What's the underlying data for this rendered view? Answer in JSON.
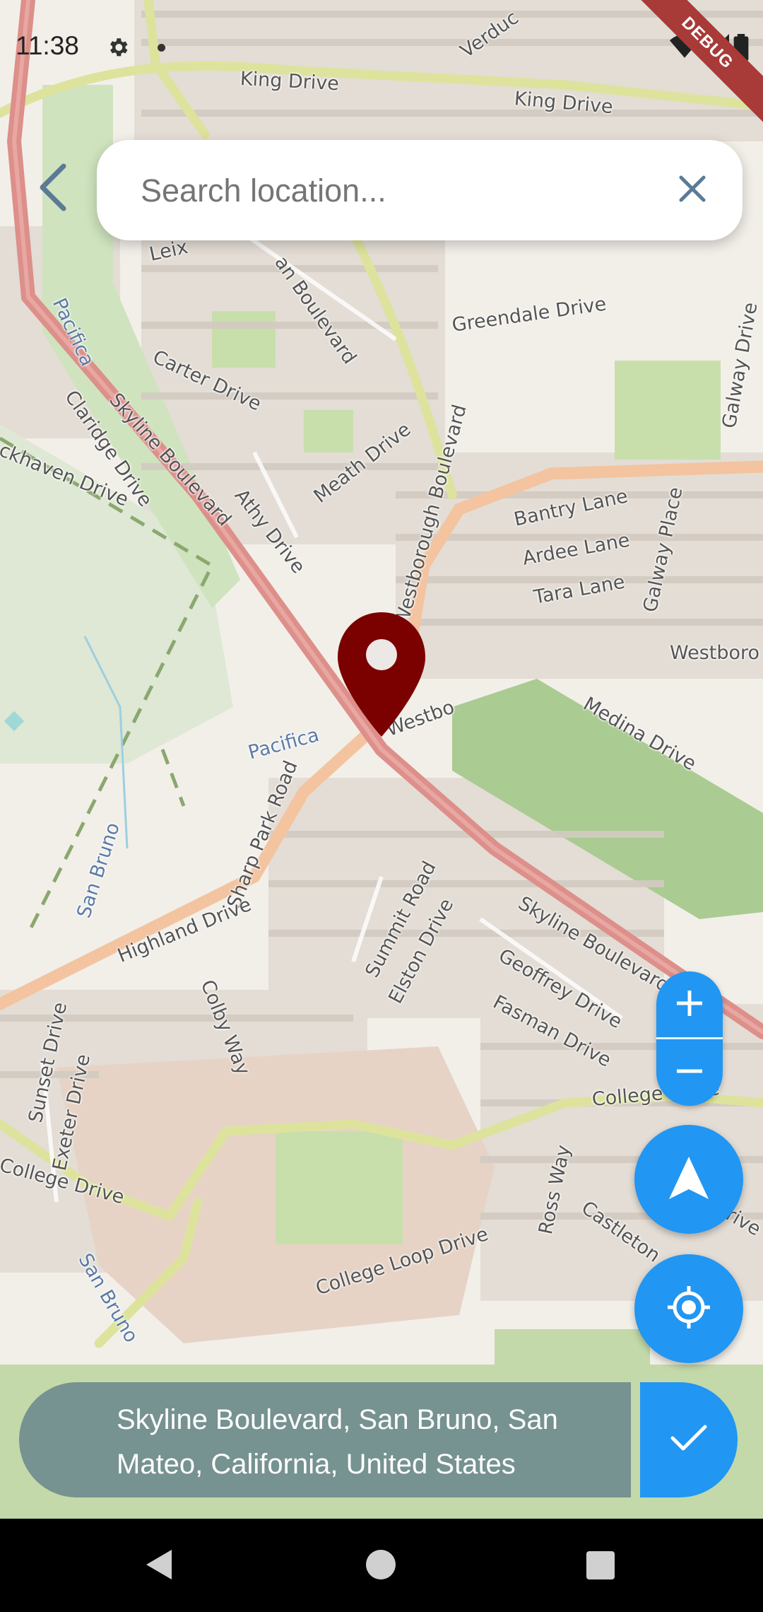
{
  "status_bar": {
    "time": "11:38",
    "debug_label": "DEBUG",
    "icons": [
      "gear-icon",
      "dot-icon",
      "wifi-icon",
      "signal-icon",
      "battery-icon"
    ]
  },
  "search": {
    "placeholder": "Search location...",
    "value": ""
  },
  "icons": {
    "back": "chevron-left-icon",
    "clear": "close-icon",
    "pin": "map-pin-icon",
    "zoom_in": "plus-icon",
    "zoom_out": "minus-icon",
    "north": "navigation-arrow-icon",
    "locate": "my-location-icon",
    "confirm": "check-icon"
  },
  "map": {
    "labels": [
      "King Drive",
      "King Drive",
      "Verduc",
      "Leix",
      "an Boulevard",
      "Greendale Drive",
      "Pacifica",
      "Carter Drive",
      "Claridge Drive",
      "Skyline Boulevard",
      "ckhaven Drive",
      "Galway Drive",
      "Meath Drive",
      "Athy Drive",
      "Bantry Lane",
      "Ardee Lane",
      "Tara Lane",
      "Galway Place",
      "Westborough Boulevard",
      "Westboro",
      "Westbo",
      "Medina Drive",
      "Pacifica",
      "Sharp Park Road",
      "San Bruno",
      "Highland Drive",
      "Summit Road",
      "Elston Drive",
      "Skyline Boulevard",
      "Geoffrey Drive",
      "Fasman Drive",
      "Colby Way",
      "Sunset Drive",
      "Exeter Drive",
      "College Drive",
      "College Drive",
      "Ross Way",
      "Castleton",
      "College Loop Drive",
      "San Bruno",
      "rive"
    ]
  },
  "address": {
    "text": "Skyline Boulevard, San Bruno, San Mateo, California, United States"
  },
  "colors": {
    "accent": "#2196f3",
    "pin": "#7b0000",
    "address_panel": "#607d8b",
    "major_road": "#dd8f8a",
    "secondary_road": "#f3c49f",
    "tertiary_road": "#dde39c",
    "park": "#c8dfac"
  }
}
